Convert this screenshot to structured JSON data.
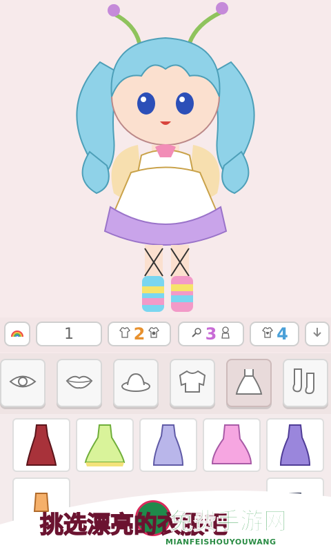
{
  "toolbar": {
    "page_number": "1",
    "set1_count": "2",
    "set2_count": "3",
    "set3_count": "4",
    "rainbow_icon": "rainbow-icon",
    "download_icon": "arrow-down-icon"
  },
  "categories": [
    {
      "name": "eye",
      "icon": "eye-icon"
    },
    {
      "name": "lips",
      "icon": "lips-icon"
    },
    {
      "name": "hat",
      "icon": "hat-icon"
    },
    {
      "name": "sweater",
      "icon": "sweater-icon"
    },
    {
      "name": "dress",
      "icon": "dress-icon",
      "selected": true
    },
    {
      "name": "socks",
      "icon": "socks-icon"
    }
  ],
  "items": [
    {
      "color": "#a8323a",
      "accent": "#7a1f26"
    },
    {
      "color": "#d9f39a",
      "accent": "#9bd35a"
    },
    {
      "color": "#b9b6ea",
      "accent": "#8c88cf"
    },
    {
      "color": "#f6a6e1",
      "accent": "#d88ad3"
    },
    {
      "color": "#9a86dc",
      "accent": "#6f5ab8"
    }
  ],
  "promo": {
    "text": "挑选漂亮的衣服吧",
    "watermark": "免费手游网",
    "watermark_sub": "MIANFEISHOUYOUWANG"
  }
}
